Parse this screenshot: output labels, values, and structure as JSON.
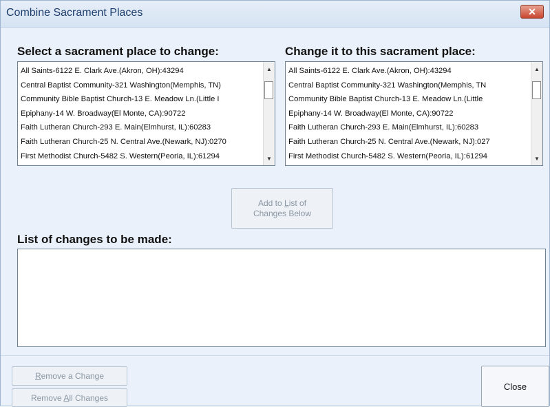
{
  "window": {
    "title": "Combine Sacrament Places",
    "close_glyph": "✕"
  },
  "left": {
    "heading": "Select a sacrament place to change:",
    "items": [
      "All Saints-6122 E. Clark Ave.(Akron, OH):43294",
      "Central Baptist Community-321 Washington(Memphis, TN)",
      "Community Bible Baptist Church-13 E. Meadow Ln.(Little I",
      "Epiphany-14 W. Broadway(El Monte, CA):90722",
      "Faith Lutheran Church-293 E. Main(Elmhurst, IL):60283",
      "Faith Lutheran Church-25 N. Central Ave.(Newark, NJ):0270",
      "First Methodist Church-5482 S. Western(Peoria, IL):61294"
    ]
  },
  "right": {
    "heading": "Change it to this sacrament place:",
    "items": [
      "All Saints-6122 E. Clark Ave.(Akron, OH):43294",
      "Central Baptist Community-321 Washington(Memphis, TN",
      "Community Bible Baptist Church-13 E. Meadow Ln.(Little",
      "Epiphany-14 W. Broadway(El Monte, CA):90722",
      "Faith Lutheran Church-293 E. Main(Elmhurst, IL):60283",
      "Faith Lutheran Church-25 N. Central Ave.(Newark, NJ):027",
      "First Methodist Church-5482 S. Western(Peoria, IL):61294"
    ]
  },
  "add_button": {
    "line1_pre": "Add to ",
    "line1_u": "L",
    "line1_post": "ist of",
    "line2": "Changes Below"
  },
  "changes": {
    "heading": "List of changes to be made:"
  },
  "remove_button": {
    "u": "R",
    "rest": "emove a Change"
  },
  "remove_all_button": {
    "pre": "Remove ",
    "u": "A",
    "post": "ll Changes"
  },
  "close_button": {
    "label": "Close"
  },
  "icons": {
    "scroll_up": "up-arrow-icon",
    "scroll_down": "down-arrow-icon"
  }
}
